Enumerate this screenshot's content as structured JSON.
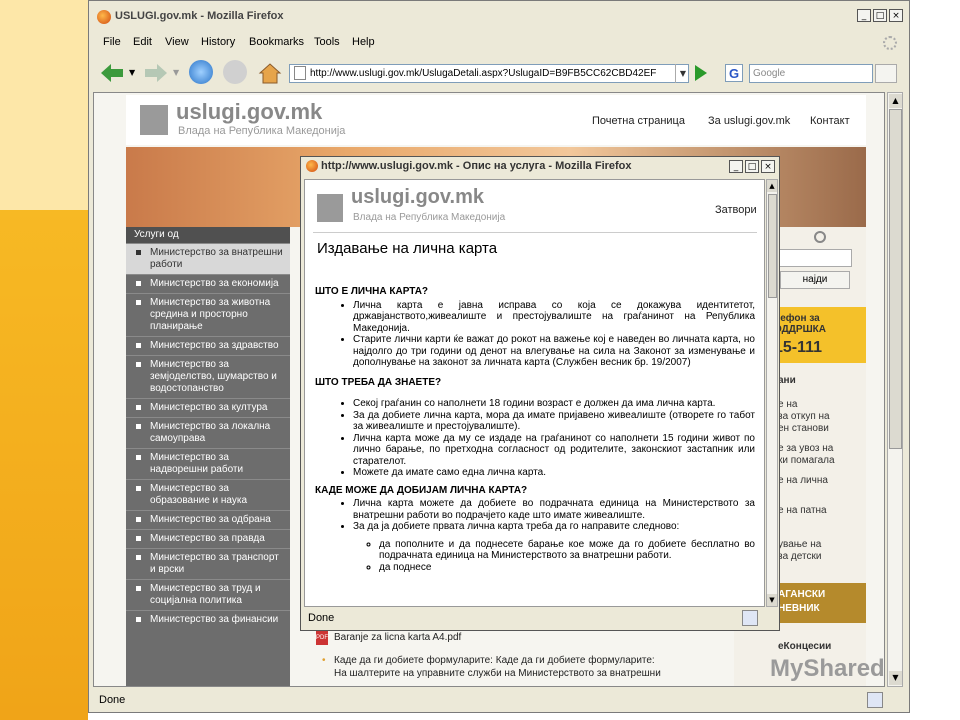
{
  "browser": {
    "title": "USLUGI.gov.mk - Mozilla Firefox",
    "menu": [
      "File",
      "Edit",
      "View",
      "History",
      "Bookmarks",
      "Tools",
      "Help"
    ],
    "url": "http://www.uslugi.gov.mk/UslugaDetali.aspx?UslugaID=B9FB5CC62CBD42EF",
    "search_placeholder": "Google",
    "search_engine_glyph": "G",
    "status": "Done"
  },
  "site": {
    "logo": "uslugi.gov.mk",
    "logo_sub": "Влада на Република Македонија",
    "nav": [
      "Почетна страница",
      "За uslugi.gov.mk",
      "Контакт"
    ],
    "sidebar_head": "Услуги од",
    "ministries": [
      "Министерство за внатрешни работи",
      "Министерство за економија",
      "Министерство за животна средина и просторно планирање",
      "Министерство за здравство",
      "Министерство за земјоделство, шумарство и водостопанство",
      "Министерство за култура",
      "Министерство за локална самоуправа",
      "Министерство за надворешни работи",
      "Министерство за образование и наука",
      "Министерство за одбрана",
      "Министерство за правда",
      "Министерство за транспорт и врски",
      "Министерство за труд и социјална политика",
      "Министерство за финансии"
    ],
    "find_button": "најди",
    "phone": {
      "l1": "лефон за",
      "l2": "ОДДРШКА",
      "l3": "15-111"
    },
    "right_label": "ани",
    "right_lines": [
      "е на",
      "за откуп на",
      "ен станови",
      "",
      "е за увоз на",
      "ки помагала",
      "",
      "е на лична",
      "",
      "е на патна",
      "",
      "ување на",
      "за детски"
    ],
    "dark_box": [
      "АГАНСКИ",
      "НЕВНИК"
    ],
    "koncesii": "еКонцесии",
    "attachment": "Baranje za licna karta A4.pdf",
    "bg_line1": "Каде да ги добиете формуларите: Каде да ги добиете формуларите:",
    "bg_line2": "На шалтерите на управните служби на Министерството за внатрешни"
  },
  "popup": {
    "title": "http://www.uslugi.gov.mk - Опис на услуга - Mozilla Firefox",
    "close_link": "Затвори",
    "heading": "Издавање на лична карта",
    "sections": [
      {
        "title": "ШТО Е ЛИЧНА КАРТА?",
        "items": [
          "Лична карта е јавна исправа со која се докажува идентитетот, државјанството,живеалиште и престојувалиште на граѓанинот на Република Македонија.",
          "Старите лични карти ќе важат до рокот на важење кој е наведен во личната карта, но најдолго до три години од денот на влегување на сила на Законот за изменување и дополнување на законот за личната карта (Службен весник бр. 19/2007)"
        ]
      },
      {
        "title": "ШТО ТРЕБА ДА ЗНАЕТЕ?",
        "items": [
          "Секој граѓанин со наполнети 18 години возраст е должен да има лична карта.",
          "За да добиете лична карта, мора да имате пријавено живеалиште (отворете го табот за живеалиште и престојувалиште).",
          "Лична карта може да му се издаде на граѓанинот со наполнети 15 години живот по лично барање, по претходна согласност од родителите, законскиот застапник или старателот.",
          "Можете да имате само една лична карта."
        ]
      },
      {
        "title": "КАДЕ МОЖЕ ДА ДОБИЈАМ ЛИЧНА КАРТА?",
        "items": [
          "Лична карта можете да добиете во подрачната единица на Министерството за внатрешни работи во подрачјето каде што имате живеалиште.",
          "За да ја добиете првата лична карта треба да го направите следново:"
        ],
        "subitems": [
          "да пополните и да поднесете барање кое може да го добиете бесплатно во подрачната единица на Министерството за внатрешни работи.",
          "да поднесе"
        ]
      }
    ],
    "status": "Done"
  },
  "watermark": "MyShared"
}
